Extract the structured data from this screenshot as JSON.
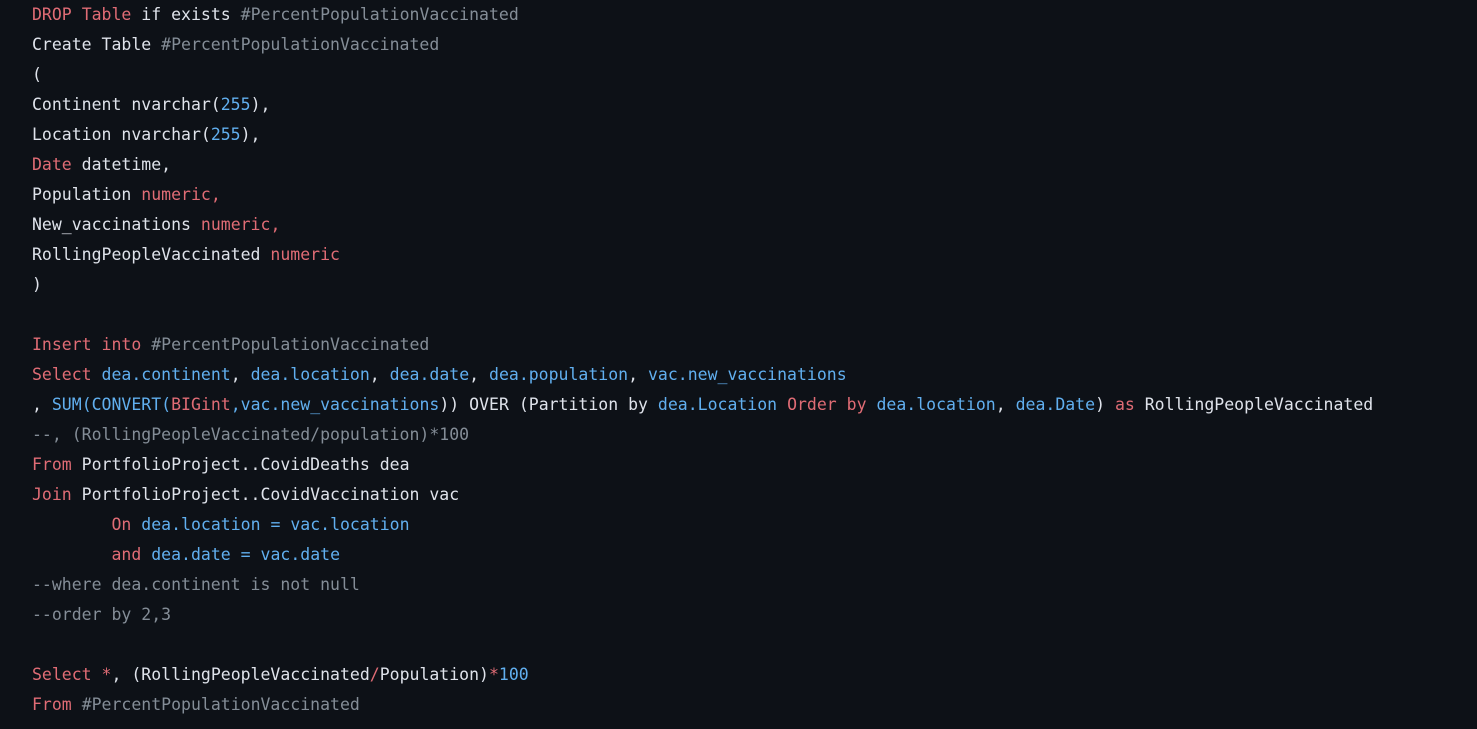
{
  "theme": {
    "background": "#0d1117",
    "keyword_color": "#e06c75",
    "identifier_color": "#61afef",
    "number_color": "#61afef",
    "plain_color": "#dfe3eb",
    "comment_color": "#848d97",
    "operator_color": "#e06c75"
  },
  "editor": {
    "language": "SQL",
    "line_count": 24
  },
  "code": {
    "lines": [
      {
        "id": "line-1",
        "tokens": [
          {
            "t": "DROP",
            "c": "kw"
          },
          {
            "t": " ",
            "c": "txt"
          },
          {
            "t": "Table",
            "c": "kw"
          },
          {
            "t": " if exists ",
            "c": "txt"
          },
          {
            "t": "#PercentPopulationVaccinated",
            "c": "temp"
          }
        ]
      },
      {
        "id": "line-2",
        "tokens": [
          {
            "t": "Create Table ",
            "c": "txt"
          },
          {
            "t": "#PercentPopulationVaccinated",
            "c": "temp"
          }
        ]
      },
      {
        "id": "line-3",
        "tokens": [
          {
            "t": "(",
            "c": "txt"
          }
        ]
      },
      {
        "id": "line-4",
        "tokens": [
          {
            "t": "Continent nvarchar(",
            "c": "txt"
          },
          {
            "t": "255",
            "c": "num"
          },
          {
            "t": "),",
            "c": "txt"
          }
        ]
      },
      {
        "id": "line-5",
        "tokens": [
          {
            "t": "Location nvarchar(",
            "c": "txt"
          },
          {
            "t": "255",
            "c": "num"
          },
          {
            "t": "),",
            "c": "txt"
          }
        ]
      },
      {
        "id": "line-6",
        "tokens": [
          {
            "t": "Date",
            "c": "kw"
          },
          {
            "t": " datetime,",
            "c": "txt"
          }
        ]
      },
      {
        "id": "line-7",
        "tokens": [
          {
            "t": "Population ",
            "c": "txt"
          },
          {
            "t": "numeric",
            "c": "kw"
          },
          {
            "t": ",",
            "c": "kw"
          }
        ]
      },
      {
        "id": "line-8",
        "tokens": [
          {
            "t": "New_vaccinations ",
            "c": "txt"
          },
          {
            "t": "numeric",
            "c": "kw"
          },
          {
            "t": ",",
            "c": "kw"
          }
        ]
      },
      {
        "id": "line-9",
        "tokens": [
          {
            "t": "RollingPeopleVaccinated ",
            "c": "txt"
          },
          {
            "t": "numeric",
            "c": "kw"
          }
        ]
      },
      {
        "id": "line-10",
        "tokens": [
          {
            "t": ")",
            "c": "txt"
          }
        ]
      },
      {
        "id": "line-11",
        "tokens": []
      },
      {
        "id": "line-12",
        "tokens": [
          {
            "t": "Insert into",
            "c": "kw"
          },
          {
            "t": " ",
            "c": "txt"
          },
          {
            "t": "#PercentPopulationVaccinated",
            "c": "temp"
          }
        ]
      },
      {
        "id": "line-13",
        "tokens": [
          {
            "t": "Select",
            "c": "kw"
          },
          {
            "t": " ",
            "c": "txt"
          },
          {
            "t": "dea.continent",
            "c": "id"
          },
          {
            "t": ", ",
            "c": "txt"
          },
          {
            "t": "dea.location",
            "c": "id"
          },
          {
            "t": ", ",
            "c": "txt"
          },
          {
            "t": "dea.date",
            "c": "id"
          },
          {
            "t": ", ",
            "c": "txt"
          },
          {
            "t": "dea.population",
            "c": "id"
          },
          {
            "t": ", ",
            "c": "txt"
          },
          {
            "t": "vac.new_vaccinations",
            "c": "id"
          }
        ]
      },
      {
        "id": "line-14",
        "tokens": [
          {
            "t": ", ",
            "c": "txt"
          },
          {
            "t": "SUM",
            "c": "id"
          },
          {
            "t": "(",
            "c": "id"
          },
          {
            "t": "CONVERT",
            "c": "id"
          },
          {
            "t": "(",
            "c": "id"
          },
          {
            "t": "BIGint",
            "c": "kw"
          },
          {
            "t": ",",
            "c": "id"
          },
          {
            "t": "vac.new_vaccinations",
            "c": "id"
          },
          {
            "t": "))",
            "c": "txt"
          },
          {
            "t": " OVER (Partition by ",
            "c": "txt"
          },
          {
            "t": "dea.Location",
            "c": "id"
          },
          {
            "t": " ",
            "c": "txt"
          },
          {
            "t": "Order by",
            "c": "kw"
          },
          {
            "t": " ",
            "c": "txt"
          },
          {
            "t": "dea.location",
            "c": "id"
          },
          {
            "t": ", ",
            "c": "txt"
          },
          {
            "t": "dea.Date",
            "c": "id"
          },
          {
            "t": ") ",
            "c": "txt"
          },
          {
            "t": "as",
            "c": "kw"
          },
          {
            "t": " RollingPeopleVaccinated",
            "c": "txt"
          }
        ]
      },
      {
        "id": "line-15",
        "tokens": [
          {
            "t": "--, (RollingPeopleVaccinated/population)*100",
            "c": "cmt"
          }
        ]
      },
      {
        "id": "line-16",
        "tokens": [
          {
            "t": "From",
            "c": "kw"
          },
          {
            "t": " PortfolioProject..CovidDeaths dea",
            "c": "txt"
          }
        ]
      },
      {
        "id": "line-17",
        "tokens": [
          {
            "t": "Join",
            "c": "kw"
          },
          {
            "t": " PortfolioProject..CovidVaccination vac",
            "c": "txt"
          }
        ]
      },
      {
        "id": "line-18",
        "tokens": [
          {
            "t": "        ",
            "c": "txt"
          },
          {
            "t": "On",
            "c": "kw"
          },
          {
            "t": " ",
            "c": "txt"
          },
          {
            "t": "dea.location",
            "c": "id"
          },
          {
            "t": " = ",
            "c": "id"
          },
          {
            "t": "vac.location",
            "c": "id"
          }
        ]
      },
      {
        "id": "line-19",
        "tokens": [
          {
            "t": "        ",
            "c": "txt"
          },
          {
            "t": "and",
            "c": "kw"
          },
          {
            "t": " ",
            "c": "txt"
          },
          {
            "t": "dea.date",
            "c": "id"
          },
          {
            "t": " = ",
            "c": "id"
          },
          {
            "t": "vac.date",
            "c": "id"
          }
        ]
      },
      {
        "id": "line-20",
        "tokens": [
          {
            "t": "--where dea.continent is not null",
            "c": "cmt"
          }
        ]
      },
      {
        "id": "line-21",
        "tokens": [
          {
            "t": "--order by 2,3",
            "c": "cmt"
          }
        ]
      },
      {
        "id": "line-22",
        "tokens": []
      },
      {
        "id": "line-23",
        "tokens": [
          {
            "t": "Select",
            "c": "kw"
          },
          {
            "t": " ",
            "c": "txt"
          },
          {
            "t": "*",
            "c": "op"
          },
          {
            "t": ", (RollingPeopleVaccinated",
            "c": "txt"
          },
          {
            "t": "/",
            "c": "op"
          },
          {
            "t": "Population)",
            "c": "txt"
          },
          {
            "t": "*",
            "c": "op"
          },
          {
            "t": "100",
            "c": "num"
          }
        ]
      },
      {
        "id": "line-24",
        "tokens": [
          {
            "t": "From",
            "c": "kw"
          },
          {
            "t": " ",
            "c": "txt"
          },
          {
            "t": "#PercentPopulationVaccinated",
            "c": "temp"
          }
        ]
      }
    ]
  }
}
